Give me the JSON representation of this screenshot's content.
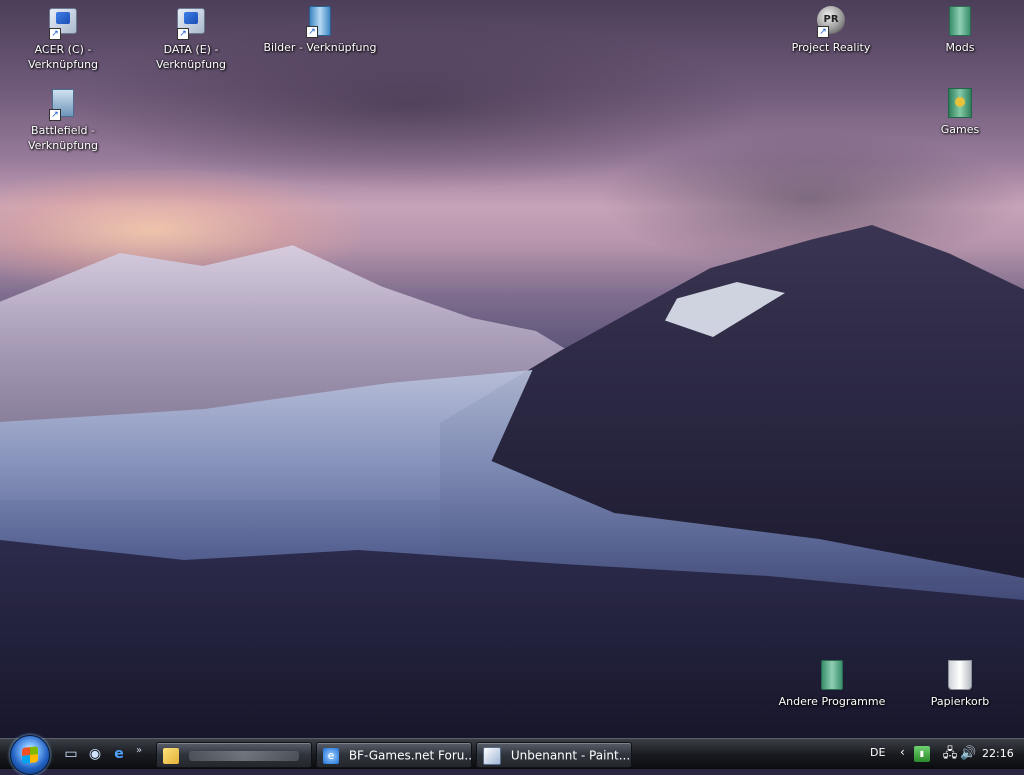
{
  "desktop": {
    "icons_left": [
      {
        "label": "ACER (C) -\nVerknüpfung",
        "icon": "drive-shortcut-icon"
      },
      {
        "label": "DATA (E) -\nVerknüpfung",
        "icon": "drive-shortcut-icon"
      },
      {
        "label": "Bilder - Verknüpfung",
        "icon": "folder-shortcut-icon"
      },
      {
        "label": "Battlefield -\nVerknüpfung",
        "icon": "game-shortcut-icon"
      }
    ],
    "icons_right": [
      {
        "label": "Project Reality",
        "icon": "project-reality-icon",
        "glyph_text": "PR"
      },
      {
        "label": "Mods",
        "icon": "folder-icon"
      },
      {
        "label": "Games",
        "icon": "games-folder-icon"
      },
      {
        "label": "Andere Programme",
        "icon": "folder-icon"
      },
      {
        "label": "Papierkorb",
        "icon": "recycle-bin-icon"
      }
    ]
  },
  "taskbar": {
    "start_button": "start-orb",
    "quicklaunch": [
      "show-desktop-icon",
      "switch-windows-icon",
      "internet-explorer-icon"
    ],
    "quicklaunch_more": "»",
    "tasks": [
      {
        "label": "",
        "icon": "folder-icon",
        "blurred": true
      },
      {
        "label": "BF-Games.net Foru...",
        "icon": "internet-explorer-icon"
      },
      {
        "label": "Unbenannt - Paint....",
        "icon": "paint-icon"
      }
    ],
    "tray": {
      "language": "DE",
      "expand": "‹",
      "icons": [
        "network-monitor-icon",
        "network-icon",
        "volume-icon"
      ],
      "time": "22:16"
    }
  },
  "colors": {
    "taskbar": "#1a1c21",
    "icon_text": "#ffffff",
    "start_orb": "#1f5fbf"
  }
}
